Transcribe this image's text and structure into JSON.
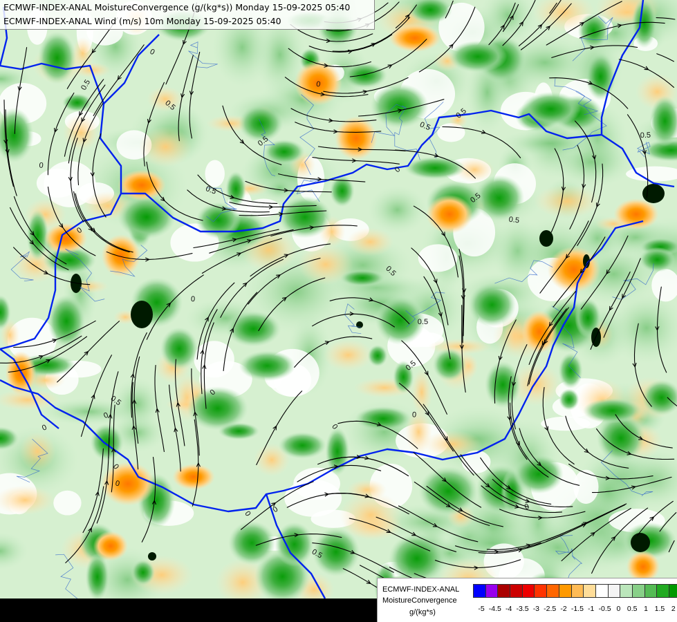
{
  "title": {
    "line1": "ECMWF-INDEX-ANAL MoistureConvergence (g/(kg*s)) Monday 15-09-2025 05:40",
    "line2": "ECMWF-INDEX-ANAL Wind (m/s) 10m Monday 15-09-2025 05:40"
  },
  "legend": {
    "model": "ECMWF-INDEX-ANAL",
    "parameter": "MoistureConvergence",
    "units": "g/(kg*s)",
    "colors": [
      "#0000ff",
      "#9900ee",
      "#aa0000",
      "#cc0000",
      "#ee0000",
      "#ff3300",
      "#ff6600",
      "#ff9900",
      "#ffbb55",
      "#ffdd99",
      "#ffffff",
      "#f4f4f4",
      "#bbe6bb",
      "#88d088",
      "#55bb55",
      "#22aa22",
      "#009900"
    ],
    "ticks": [
      "-5",
      "-4.5",
      "-4",
      "-3.5",
      "-3",
      "-2.5",
      "-2",
      "-1.5",
      "-1",
      "-0.5",
      "0",
      "0.5",
      "1",
      "1.5",
      "2"
    ]
  },
  "map": {
    "contour_labels": [
      "0",
      "0.5",
      "0",
      "0.5",
      "0",
      "0",
      "0.5",
      "0",
      "0.5",
      "0",
      "0.5",
      "0.5",
      "0",
      "0.5",
      "0",
      "0",
      "0.5",
      "0",
      "0.5",
      "0",
      "0.5",
      "0",
      "0",
      "0.5",
      "0",
      "0.5",
      "0.5",
      "0",
      "0",
      "0.5"
    ],
    "colors": {
      "border": "#0022ee",
      "river": "#3366cc",
      "streamline": "#000000",
      "convergence": "#33aa33",
      "divergence": "#ffbb66"
    }
  }
}
